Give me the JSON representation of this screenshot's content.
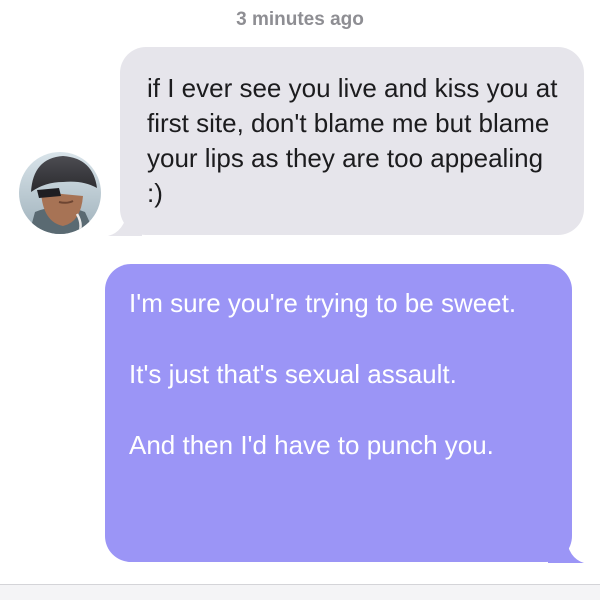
{
  "conversation": {
    "timestamp": "3 minutes ago",
    "messages": [
      {
        "direction": "incoming",
        "text": "if I ever see you live and kiss you at first site, don't blame me but blame your lips as they are too appealing :)"
      },
      {
        "direction": "outgoing",
        "paragraphs": [
          "I'm sure you're trying to be sweet.",
          "It's just that's sexual assault.",
          "And then I'd have to punch you."
        ]
      }
    ]
  },
  "colors": {
    "incoming_bubble": "#e6e5eb",
    "outgoing_bubble": "#9b95f6",
    "timestamp_text": "#8e8e93"
  }
}
